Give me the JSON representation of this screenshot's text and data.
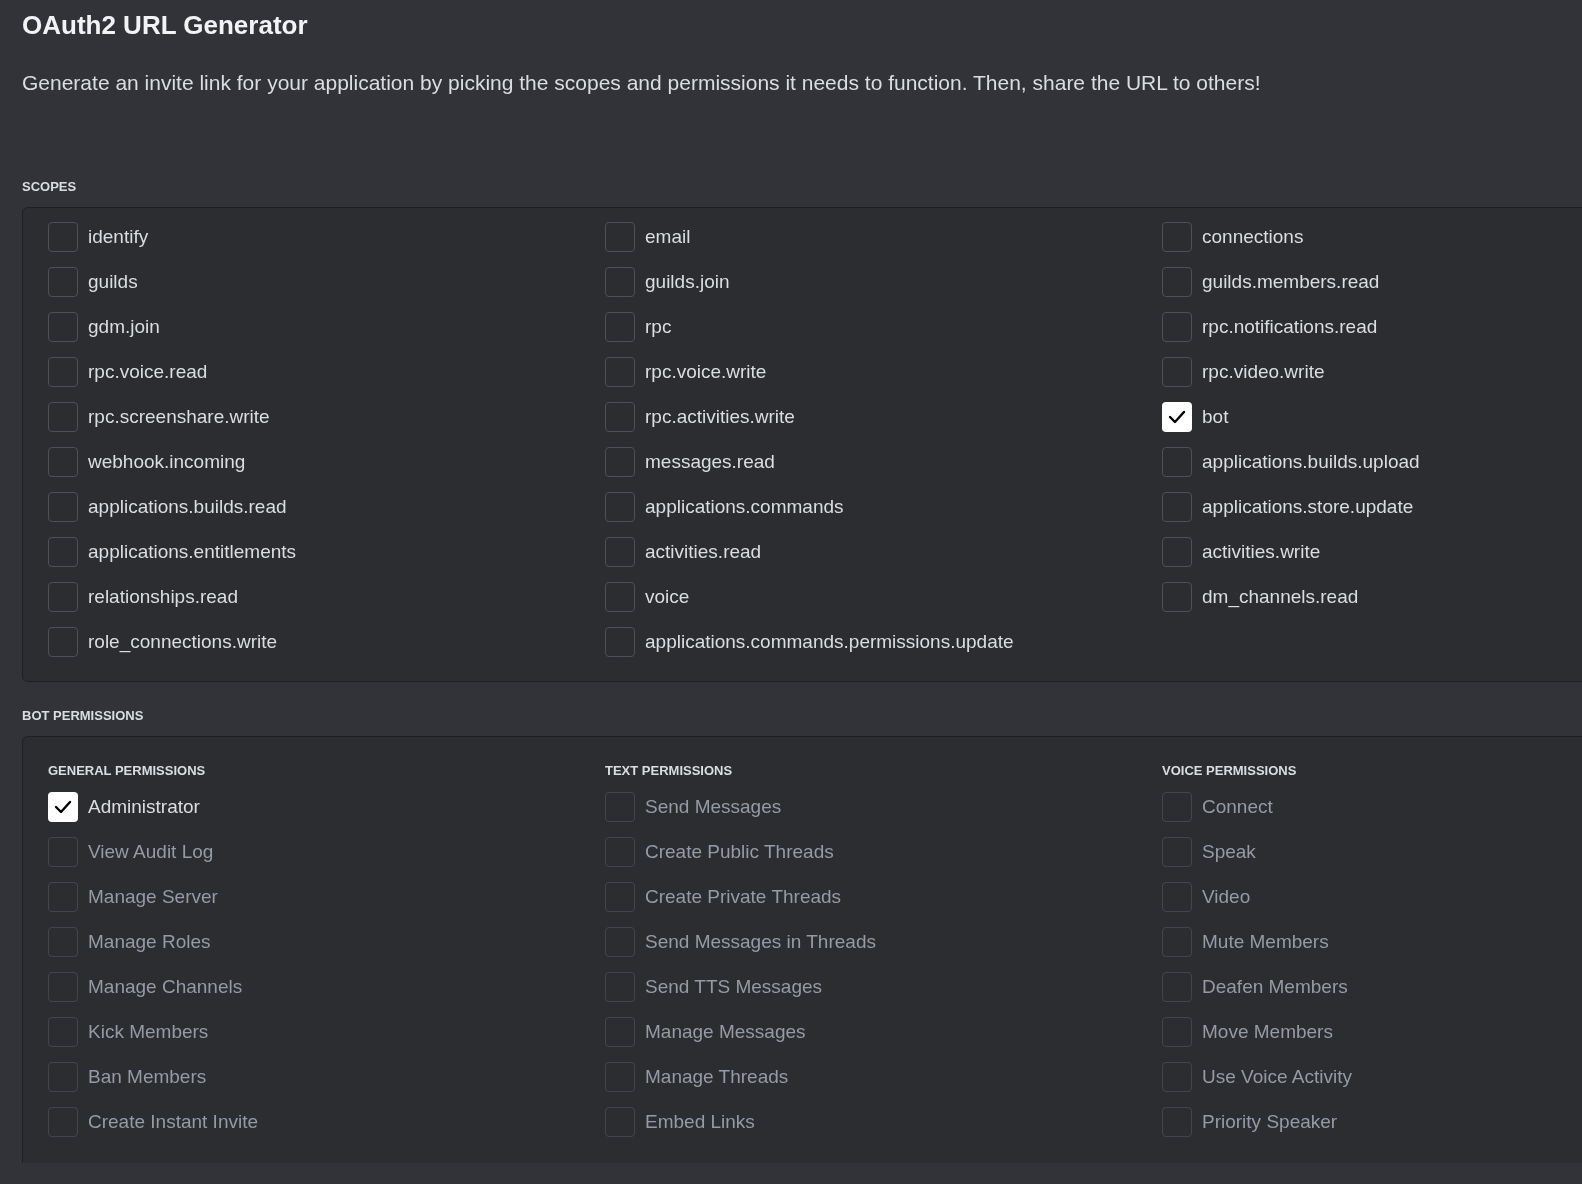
{
  "title": "OAuth2 URL Generator",
  "description": "Generate an invite link for your application by picking the scopes and permissions it needs to function. Then, share the URL to others!",
  "scopes": {
    "label": "SCOPES",
    "columns": [
      [
        {
          "label": "identify",
          "checked": false
        },
        {
          "label": "guilds",
          "checked": false
        },
        {
          "label": "gdm.join",
          "checked": false
        },
        {
          "label": "rpc.voice.read",
          "checked": false
        },
        {
          "label": "rpc.screenshare.write",
          "checked": false
        },
        {
          "label": "webhook.incoming",
          "checked": false
        },
        {
          "label": "applications.builds.read",
          "checked": false
        },
        {
          "label": "applications.entitlements",
          "checked": false
        },
        {
          "label": "relationships.read",
          "checked": false
        },
        {
          "label": "role_connections.write",
          "checked": false
        }
      ],
      [
        {
          "label": "email",
          "checked": false
        },
        {
          "label": "guilds.join",
          "checked": false
        },
        {
          "label": "rpc",
          "checked": false
        },
        {
          "label": "rpc.voice.write",
          "checked": false
        },
        {
          "label": "rpc.activities.write",
          "checked": false
        },
        {
          "label": "messages.read",
          "checked": false
        },
        {
          "label": "applications.commands",
          "checked": false
        },
        {
          "label": "activities.read",
          "checked": false
        },
        {
          "label": "voice",
          "checked": false
        },
        {
          "label": "applications.commands.permissions.update",
          "checked": false
        }
      ],
      [
        {
          "label": "connections",
          "checked": false
        },
        {
          "label": "guilds.members.read",
          "checked": false
        },
        {
          "label": "rpc.notifications.read",
          "checked": false
        },
        {
          "label": "rpc.video.write",
          "checked": false
        },
        {
          "label": "bot",
          "checked": true
        },
        {
          "label": "applications.builds.upload",
          "checked": false
        },
        {
          "label": "applications.store.update",
          "checked": false
        },
        {
          "label": "activities.write",
          "checked": false
        },
        {
          "label": "dm_channels.read",
          "checked": false
        }
      ]
    ]
  },
  "bot_permissions": {
    "label": "BOT PERMISSIONS",
    "groups": [
      {
        "title": "GENERAL PERMISSIONS",
        "items": [
          {
            "label": "Administrator",
            "checked": true,
            "disabled": false
          },
          {
            "label": "View Audit Log",
            "checked": false,
            "disabled": true
          },
          {
            "label": "Manage Server",
            "checked": false,
            "disabled": true
          },
          {
            "label": "Manage Roles",
            "checked": false,
            "disabled": true
          },
          {
            "label": "Manage Channels",
            "checked": false,
            "disabled": true
          },
          {
            "label": "Kick Members",
            "checked": false,
            "disabled": true
          },
          {
            "label": "Ban Members",
            "checked": false,
            "disabled": true
          },
          {
            "label": "Create Instant Invite",
            "checked": false,
            "disabled": true
          }
        ]
      },
      {
        "title": "TEXT PERMISSIONS",
        "items": [
          {
            "label": "Send Messages",
            "checked": false,
            "disabled": true
          },
          {
            "label": "Create Public Threads",
            "checked": false,
            "disabled": true
          },
          {
            "label": "Create Private Threads",
            "checked": false,
            "disabled": true
          },
          {
            "label": "Send Messages in Threads",
            "checked": false,
            "disabled": true
          },
          {
            "label": "Send TTS Messages",
            "checked": false,
            "disabled": true
          },
          {
            "label": "Manage Messages",
            "checked": false,
            "disabled": true
          },
          {
            "label": "Manage Threads",
            "checked": false,
            "disabled": true
          },
          {
            "label": "Embed Links",
            "checked": false,
            "disabled": true
          }
        ]
      },
      {
        "title": "VOICE PERMISSIONS",
        "items": [
          {
            "label": "Connect",
            "checked": false,
            "disabled": true
          },
          {
            "label": "Speak",
            "checked": false,
            "disabled": true
          },
          {
            "label": "Video",
            "checked": false,
            "disabled": true
          },
          {
            "label": "Mute Members",
            "checked": false,
            "disabled": true
          },
          {
            "label": "Deafen Members",
            "checked": false,
            "disabled": true
          },
          {
            "label": "Move Members",
            "checked": false,
            "disabled": true
          },
          {
            "label": "Use Voice Activity",
            "checked": false,
            "disabled": true
          },
          {
            "label": "Priority Speaker",
            "checked": false,
            "disabled": true
          }
        ]
      }
    ]
  }
}
